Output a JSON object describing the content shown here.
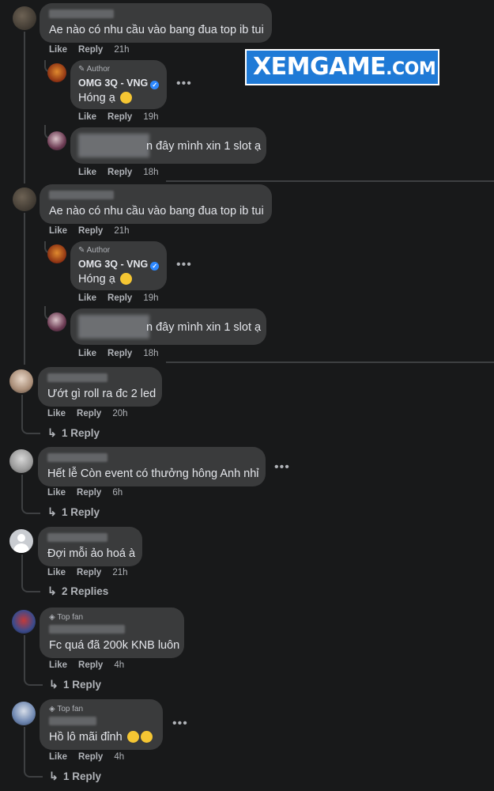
{
  "watermark": {
    "text": "XEMGAME",
    "suffix": ".COM"
  },
  "actions": {
    "like": "Like",
    "reply": "Reply"
  },
  "thread_a": {
    "comment": {
      "text": "Ae nào có nhu cầu vào bang đua top ib tui",
      "time": "21h"
    },
    "author_reply": {
      "badge": "Author",
      "name": "OMG 3Q - VNG",
      "text": "Hóng ạ",
      "time": "19h"
    },
    "user_reply": {
      "text": "n đây mình xin 1 slot ạ",
      "time": "18h"
    }
  },
  "thread_b": {
    "comment": {
      "text": "Ae nào có nhu cầu vào bang đua top ib tui",
      "time": "21h"
    },
    "author_reply": {
      "badge": "Author",
      "name": "OMG 3Q - VNG",
      "text": "Hóng ạ",
      "time": "19h"
    },
    "user_reply": {
      "text": "n đây mình xin 1 slot ạ",
      "time": "18h"
    }
  },
  "comments": [
    {
      "text": "Ướt gì roll ra đc 2 led",
      "time": "20h",
      "replies": "1 Reply"
    },
    {
      "text": "Hết lễ Còn event có thưởng hông Anh nhỉ",
      "time": "6h",
      "replies": "1 Reply"
    },
    {
      "text": "Đợi mỗi ảo hoá à",
      "time": "21h",
      "replies": "2 Replies"
    },
    {
      "badge": "Top fan",
      "text": "Fc quá đã 200k KNB luôn",
      "time": "4h",
      "replies": "1 Reply"
    },
    {
      "badge": "Top fan",
      "text": "Hồ lô mãi đỉnh",
      "time": "4h",
      "replies": "1 Reply"
    }
  ],
  "colors": {
    "background": "#18191a",
    "bubble": "#3a3b3c",
    "accent": "#2d88ff",
    "logo": "#1f7ad6"
  }
}
